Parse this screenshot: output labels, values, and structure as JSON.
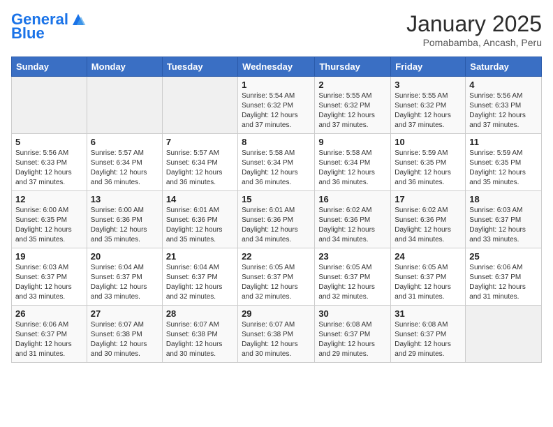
{
  "header": {
    "logo_line1": "General",
    "logo_line2": "Blue",
    "month": "January 2025",
    "location": "Pomabamba, Ancash, Peru"
  },
  "weekdays": [
    "Sunday",
    "Monday",
    "Tuesday",
    "Wednesday",
    "Thursday",
    "Friday",
    "Saturday"
  ],
  "weeks": [
    [
      {
        "day": "",
        "sunrise": "",
        "sunset": "",
        "daylight": ""
      },
      {
        "day": "",
        "sunrise": "",
        "sunset": "",
        "daylight": ""
      },
      {
        "day": "",
        "sunrise": "",
        "sunset": "",
        "daylight": ""
      },
      {
        "day": "1",
        "sunrise": "Sunrise: 5:54 AM",
        "sunset": "Sunset: 6:32 PM",
        "daylight": "Daylight: 12 hours and 37 minutes."
      },
      {
        "day": "2",
        "sunrise": "Sunrise: 5:55 AM",
        "sunset": "Sunset: 6:32 PM",
        "daylight": "Daylight: 12 hours and 37 minutes."
      },
      {
        "day": "3",
        "sunrise": "Sunrise: 5:55 AM",
        "sunset": "Sunset: 6:32 PM",
        "daylight": "Daylight: 12 hours and 37 minutes."
      },
      {
        "day": "4",
        "sunrise": "Sunrise: 5:56 AM",
        "sunset": "Sunset: 6:33 PM",
        "daylight": "Daylight: 12 hours and 37 minutes."
      }
    ],
    [
      {
        "day": "5",
        "sunrise": "Sunrise: 5:56 AM",
        "sunset": "Sunset: 6:33 PM",
        "daylight": "Daylight: 12 hours and 37 minutes."
      },
      {
        "day": "6",
        "sunrise": "Sunrise: 5:57 AM",
        "sunset": "Sunset: 6:34 PM",
        "daylight": "Daylight: 12 hours and 36 minutes."
      },
      {
        "day": "7",
        "sunrise": "Sunrise: 5:57 AM",
        "sunset": "Sunset: 6:34 PM",
        "daylight": "Daylight: 12 hours and 36 minutes."
      },
      {
        "day": "8",
        "sunrise": "Sunrise: 5:58 AM",
        "sunset": "Sunset: 6:34 PM",
        "daylight": "Daylight: 12 hours and 36 minutes."
      },
      {
        "day": "9",
        "sunrise": "Sunrise: 5:58 AM",
        "sunset": "Sunset: 6:34 PM",
        "daylight": "Daylight: 12 hours and 36 minutes."
      },
      {
        "day": "10",
        "sunrise": "Sunrise: 5:59 AM",
        "sunset": "Sunset: 6:35 PM",
        "daylight": "Daylight: 12 hours and 36 minutes."
      },
      {
        "day": "11",
        "sunrise": "Sunrise: 5:59 AM",
        "sunset": "Sunset: 6:35 PM",
        "daylight": "Daylight: 12 hours and 35 minutes."
      }
    ],
    [
      {
        "day": "12",
        "sunrise": "Sunrise: 6:00 AM",
        "sunset": "Sunset: 6:35 PM",
        "daylight": "Daylight: 12 hours and 35 minutes."
      },
      {
        "day": "13",
        "sunrise": "Sunrise: 6:00 AM",
        "sunset": "Sunset: 6:36 PM",
        "daylight": "Daylight: 12 hours and 35 minutes."
      },
      {
        "day": "14",
        "sunrise": "Sunrise: 6:01 AM",
        "sunset": "Sunset: 6:36 PM",
        "daylight": "Daylight: 12 hours and 35 minutes."
      },
      {
        "day": "15",
        "sunrise": "Sunrise: 6:01 AM",
        "sunset": "Sunset: 6:36 PM",
        "daylight": "Daylight: 12 hours and 34 minutes."
      },
      {
        "day": "16",
        "sunrise": "Sunrise: 6:02 AM",
        "sunset": "Sunset: 6:36 PM",
        "daylight": "Daylight: 12 hours and 34 minutes."
      },
      {
        "day": "17",
        "sunrise": "Sunrise: 6:02 AM",
        "sunset": "Sunset: 6:36 PM",
        "daylight": "Daylight: 12 hours and 34 minutes."
      },
      {
        "day": "18",
        "sunrise": "Sunrise: 6:03 AM",
        "sunset": "Sunset: 6:37 PM",
        "daylight": "Daylight: 12 hours and 33 minutes."
      }
    ],
    [
      {
        "day": "19",
        "sunrise": "Sunrise: 6:03 AM",
        "sunset": "Sunset: 6:37 PM",
        "daylight": "Daylight: 12 hours and 33 minutes."
      },
      {
        "day": "20",
        "sunrise": "Sunrise: 6:04 AM",
        "sunset": "Sunset: 6:37 PM",
        "daylight": "Daylight: 12 hours and 33 minutes."
      },
      {
        "day": "21",
        "sunrise": "Sunrise: 6:04 AM",
        "sunset": "Sunset: 6:37 PM",
        "daylight": "Daylight: 12 hours and 32 minutes."
      },
      {
        "day": "22",
        "sunrise": "Sunrise: 6:05 AM",
        "sunset": "Sunset: 6:37 PM",
        "daylight": "Daylight: 12 hours and 32 minutes."
      },
      {
        "day": "23",
        "sunrise": "Sunrise: 6:05 AM",
        "sunset": "Sunset: 6:37 PM",
        "daylight": "Daylight: 12 hours and 32 minutes."
      },
      {
        "day": "24",
        "sunrise": "Sunrise: 6:05 AM",
        "sunset": "Sunset: 6:37 PM",
        "daylight": "Daylight: 12 hours and 31 minutes."
      },
      {
        "day": "25",
        "sunrise": "Sunrise: 6:06 AM",
        "sunset": "Sunset: 6:37 PM",
        "daylight": "Daylight: 12 hours and 31 minutes."
      }
    ],
    [
      {
        "day": "26",
        "sunrise": "Sunrise: 6:06 AM",
        "sunset": "Sunset: 6:37 PM",
        "daylight": "Daylight: 12 hours and 31 minutes."
      },
      {
        "day": "27",
        "sunrise": "Sunrise: 6:07 AM",
        "sunset": "Sunset: 6:38 PM",
        "daylight": "Daylight: 12 hours and 30 minutes."
      },
      {
        "day": "28",
        "sunrise": "Sunrise: 6:07 AM",
        "sunset": "Sunset: 6:38 PM",
        "daylight": "Daylight: 12 hours and 30 minutes."
      },
      {
        "day": "29",
        "sunrise": "Sunrise: 6:07 AM",
        "sunset": "Sunset: 6:38 PM",
        "daylight": "Daylight: 12 hours and 30 minutes."
      },
      {
        "day": "30",
        "sunrise": "Sunrise: 6:08 AM",
        "sunset": "Sunset: 6:37 PM",
        "daylight": "Daylight: 12 hours and 29 minutes."
      },
      {
        "day": "31",
        "sunrise": "Sunrise: 6:08 AM",
        "sunset": "Sunset: 6:37 PM",
        "daylight": "Daylight: 12 hours and 29 minutes."
      },
      {
        "day": "",
        "sunrise": "",
        "sunset": "",
        "daylight": ""
      }
    ]
  ]
}
